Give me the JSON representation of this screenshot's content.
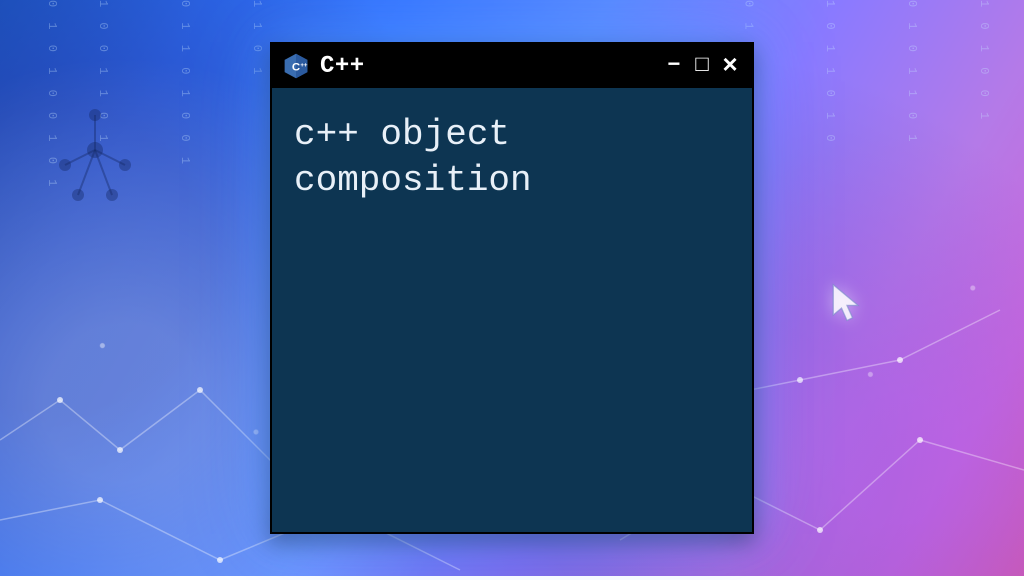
{
  "window": {
    "title": "C++",
    "logo_label": "C++",
    "icon_color": "#2b5a9e",
    "controls": {
      "minimize": "−",
      "maximize": "□",
      "close": "×"
    },
    "content": "c++ object\ncomposition"
  },
  "colors": {
    "window_bg": "#0d3552",
    "accent": "#2b6cf0"
  }
}
